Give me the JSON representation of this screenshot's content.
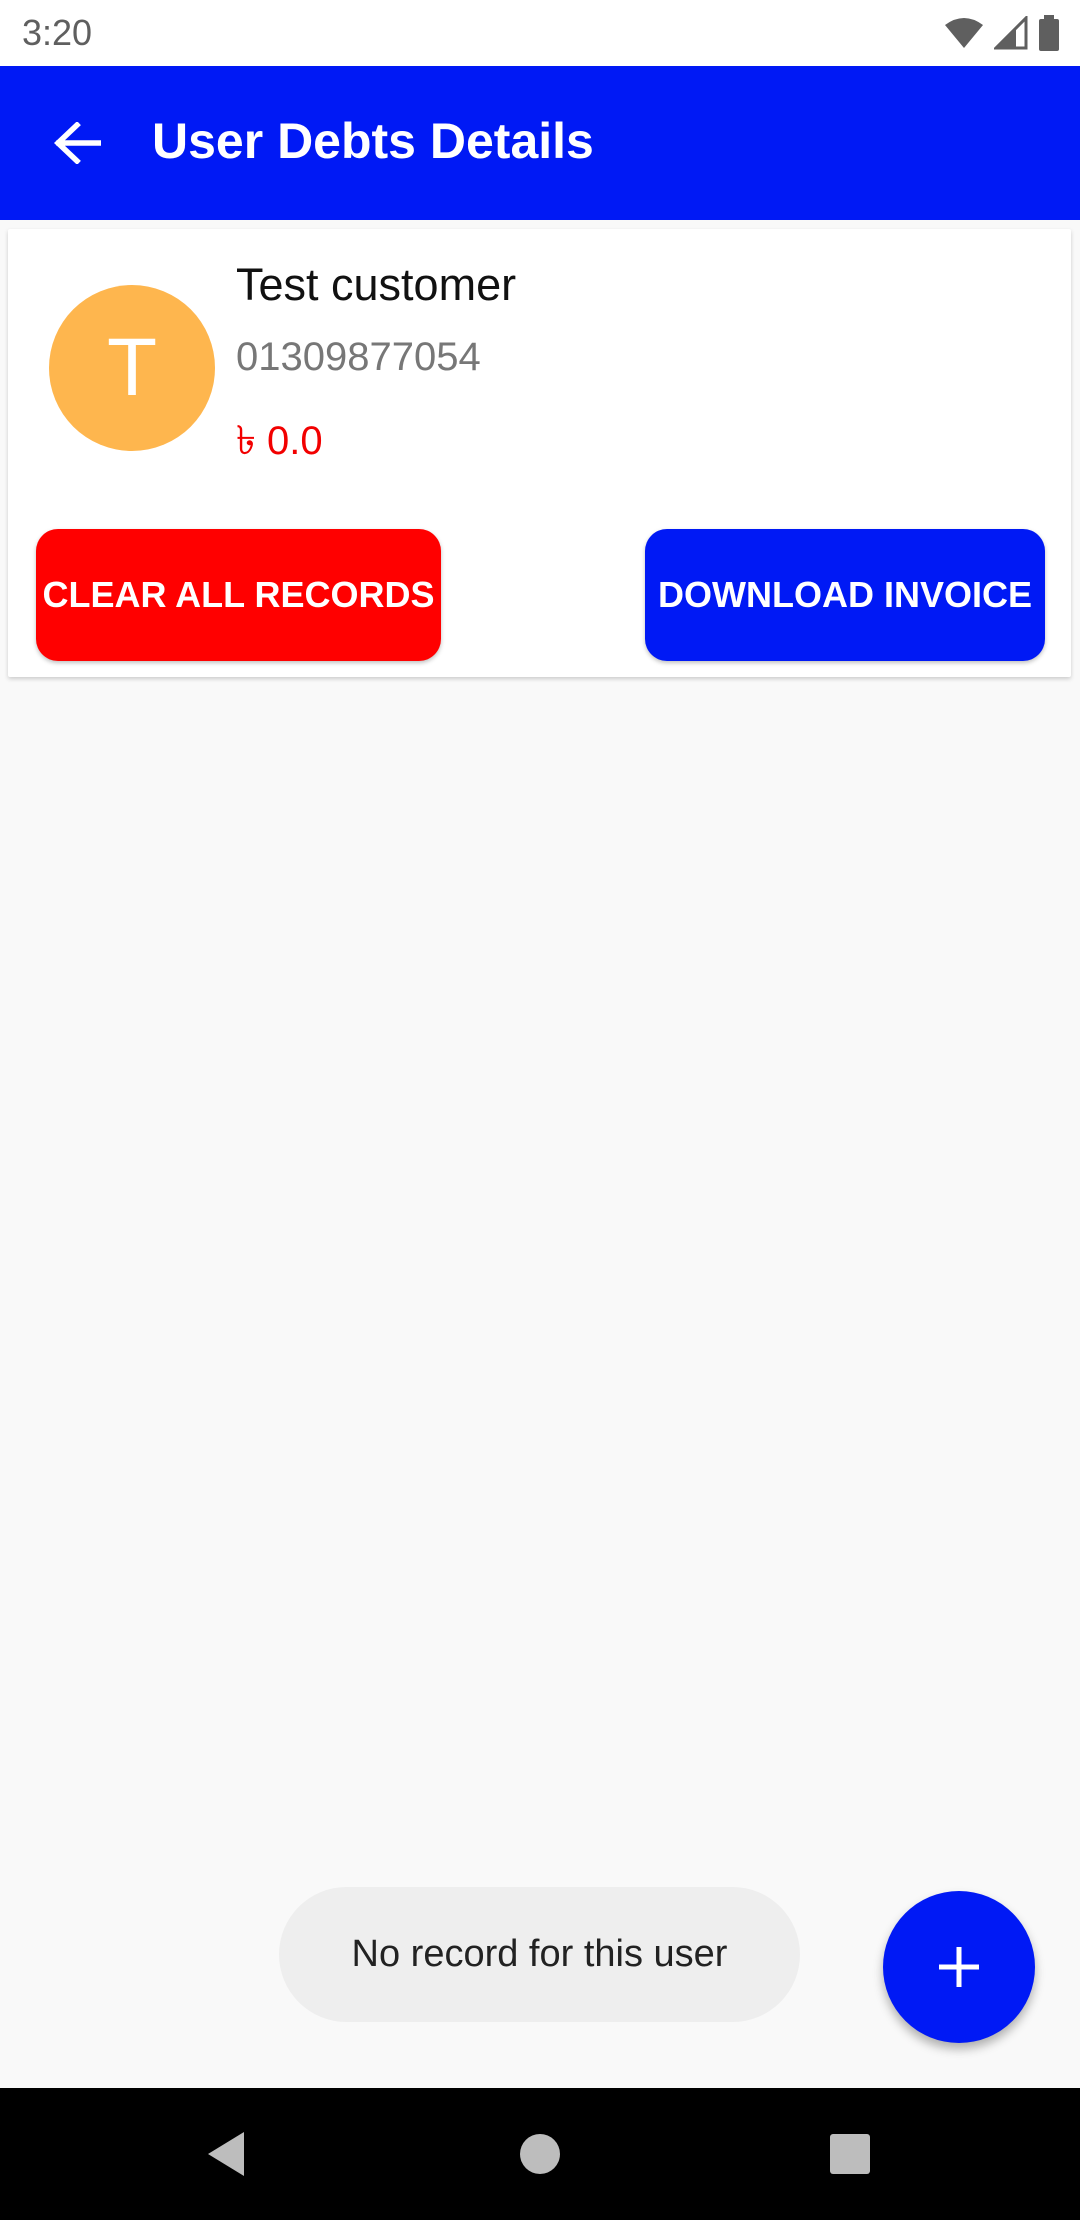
{
  "status_bar": {
    "time": "3:20",
    "icons": [
      "wifi-icon",
      "cell-signal-icon",
      "battery-icon"
    ]
  },
  "app_bar": {
    "title": "User Debts Details",
    "back_icon": "arrow-left-icon",
    "color": "#0019f5"
  },
  "customer": {
    "initial": "T",
    "name": "Test customer",
    "phone": "01309877054",
    "amount": "৳ 0.0",
    "avatar_color": "#feb64e",
    "amount_color": "#f20000"
  },
  "actions": {
    "clear_label": "CLEAR ALL RECORDS",
    "clear_color": "#ff0000",
    "download_label": "DOWNLOAD INVOICE",
    "download_color": "#0019f5"
  },
  "toast": {
    "message": "No record for this user"
  },
  "fab": {
    "icon": "plus-icon"
  },
  "nav_bar": {
    "icons": [
      "back-triangle-icon",
      "home-circle-icon",
      "recents-square-icon"
    ]
  }
}
